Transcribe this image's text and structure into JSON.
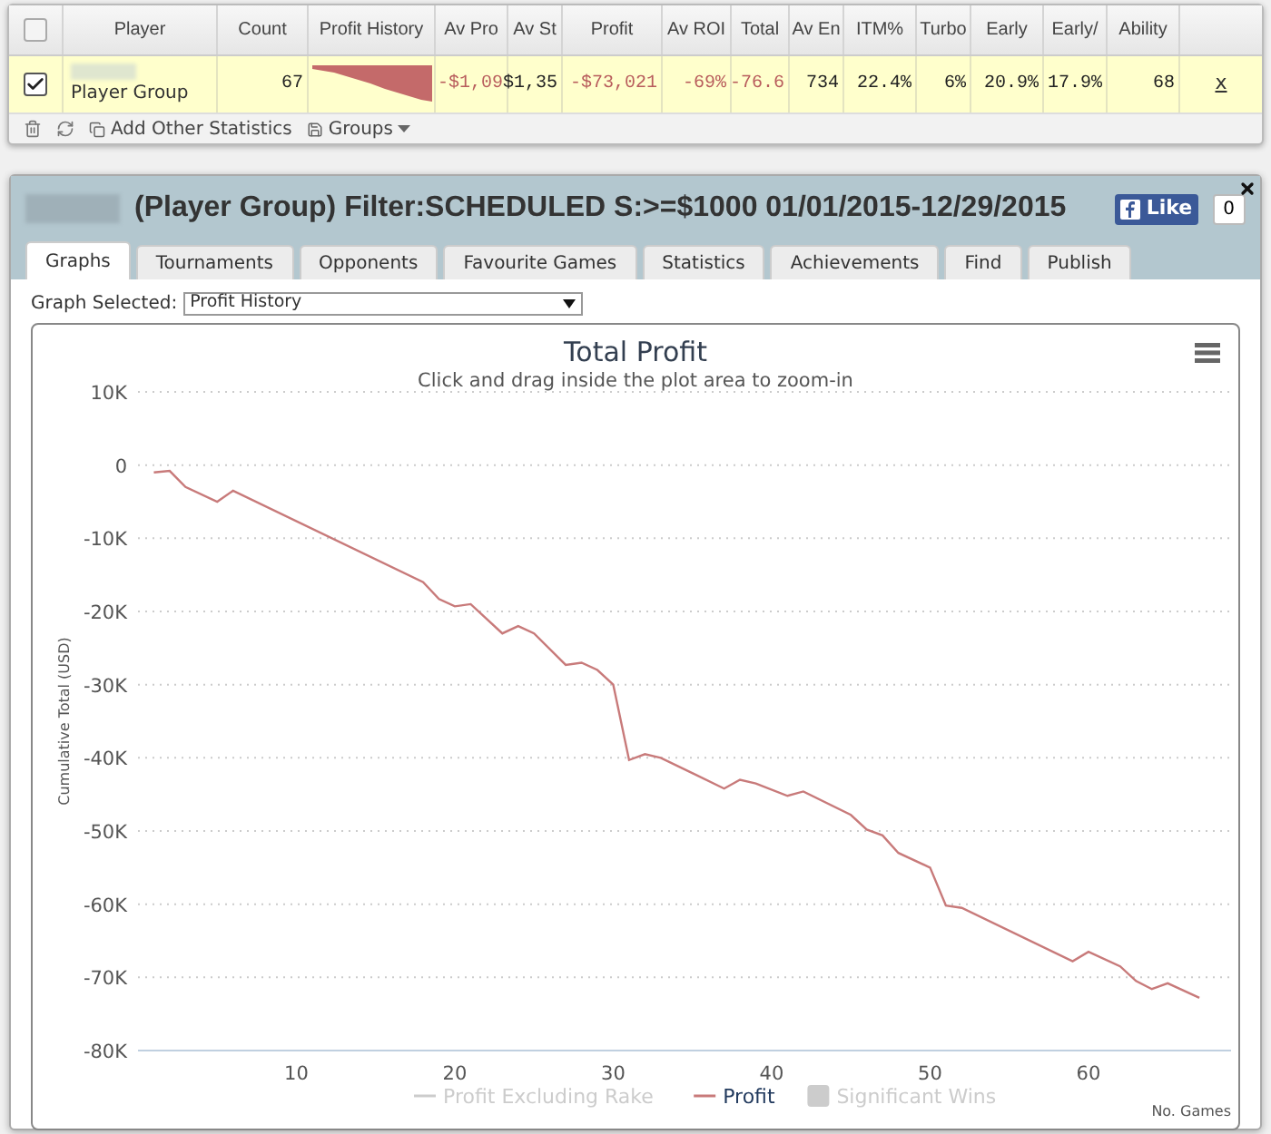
{
  "stats_table": {
    "all_checked": false,
    "columns": [
      "Player",
      "Count",
      "Profit History",
      "Av Pro",
      "Av St",
      "Profit",
      "Av ROI",
      "Total",
      "Av En",
      "ITM%",
      "Turbo",
      "Early",
      "Early/",
      "Ability"
    ],
    "rows": [
      {
        "checked": true,
        "remove": "x",
        "cells": [
          {
            "kind": "player",
            "text": "Player Group"
          },
          {
            "kind": "text",
            "text": "67",
            "negative": false
          },
          {
            "kind": "sparkline"
          },
          {
            "kind": "text",
            "text": "-$1,09",
            "negative": true
          },
          {
            "kind": "text",
            "text": "$1,35",
            "negative": false
          },
          {
            "kind": "text",
            "text": "-$73,021",
            "negative": true
          },
          {
            "kind": "text",
            "text": "-69%",
            "negative": true
          },
          {
            "kind": "text",
            "text": "-76.6",
            "negative": true
          },
          {
            "kind": "text",
            "text": "734",
            "negative": false
          },
          {
            "kind": "text",
            "text": "22.4%",
            "negative": false
          },
          {
            "kind": "text",
            "text": "6%",
            "negative": false
          },
          {
            "kind": "text",
            "text": "20.9%",
            "negative": false
          },
          {
            "kind": "text",
            "text": "17.9%",
            "negative": false
          },
          {
            "kind": "text",
            "text": "68",
            "negative": false
          }
        ]
      }
    ],
    "toolbar": {
      "add_label": "Add Other Statistics",
      "groups_label": "Groups"
    }
  },
  "panel": {
    "title": "(Player Group) Filter:SCHEDULED S:>=$1000 01/01/2015-12/29/2015",
    "like_label": "Like",
    "like_count": "0",
    "tabs": [
      {
        "label": "Graphs",
        "selected": true
      },
      {
        "label": "Tournaments",
        "selected": false
      },
      {
        "label": "Opponents",
        "selected": false
      },
      {
        "label": "Favourite Games",
        "selected": false
      },
      {
        "label": "Statistics",
        "selected": false
      },
      {
        "label": "Achievements",
        "selected": false
      },
      {
        "label": "Find",
        "selected": false
      },
      {
        "label": "Publish",
        "selected": false
      }
    ],
    "graph_select": {
      "label": "Graph Selected:",
      "value": "Profit History"
    },
    "chart": {
      "subtitle": "Click and drag inside the plot area to zoom-in",
      "legend": [
        {
          "label": "Profit Excluding Rake",
          "kind": "line",
          "visible": false
        },
        {
          "kind": "series",
          "visible": true
        },
        {
          "label": "Significant Wins",
          "kind": "box",
          "visible": false
        }
      ],
      "chart_data": {
        "type": "line",
        "title": "Total Profit",
        "xlabel": "No. Games",
        "ylabel": "Cumulative Total (USD)",
        "x": [
          1,
          2,
          3,
          5,
          6,
          18,
          19,
          20,
          21,
          23,
          24,
          25,
          27,
          28,
          29,
          30,
          31,
          32,
          33,
          37,
          38,
          39,
          41,
          42,
          45,
          46,
          47,
          48,
          50,
          51,
          52,
          59,
          60,
          62,
          63,
          64,
          65,
          67
        ],
        "series": [
          {
            "name": "Profit",
            "color": "#c87a7a",
            "values": [
              -1000,
              -800,
              -3000,
              -5000,
              -3500,
              -16000,
              -18300,
              -19300,
              -19000,
              -23000,
              -22000,
              -23000,
              -27300,
              -27000,
              -28000,
              -30000,
              -40300,
              -39500,
              -40000,
              -44200,
              -43000,
              -43500,
              -45200,
              -44600,
              -47800,
              -49800,
              -50600,
              -53000,
              -55000,
              -60200,
              -60500,
              -67800,
              -66500,
              -68500,
              -70500,
              -71600,
              -70800,
              -72800
            ]
          }
        ],
        "grid": true,
        "xlim": [
          0,
          69
        ],
        "ylim": [
          -80000,
          10000
        ],
        "xticks": [
          10,
          20,
          30,
          40,
          50,
          60
        ],
        "yticks": [
          {
            "value": 10000,
            "label": "10K"
          },
          {
            "value": 0,
            "label": "0"
          },
          {
            "value": -10000,
            "label": "-10K"
          },
          {
            "value": -20000,
            "label": "-20K"
          },
          {
            "value": -30000,
            "label": "-30K"
          },
          {
            "value": -40000,
            "label": "-40K"
          },
          {
            "value": -50000,
            "label": "-50K"
          },
          {
            "value": -60000,
            "label": "-60K"
          },
          {
            "value": -70000,
            "label": "-70K"
          },
          {
            "value": -80000,
            "label": "-80K"
          }
        ]
      }
    }
  }
}
